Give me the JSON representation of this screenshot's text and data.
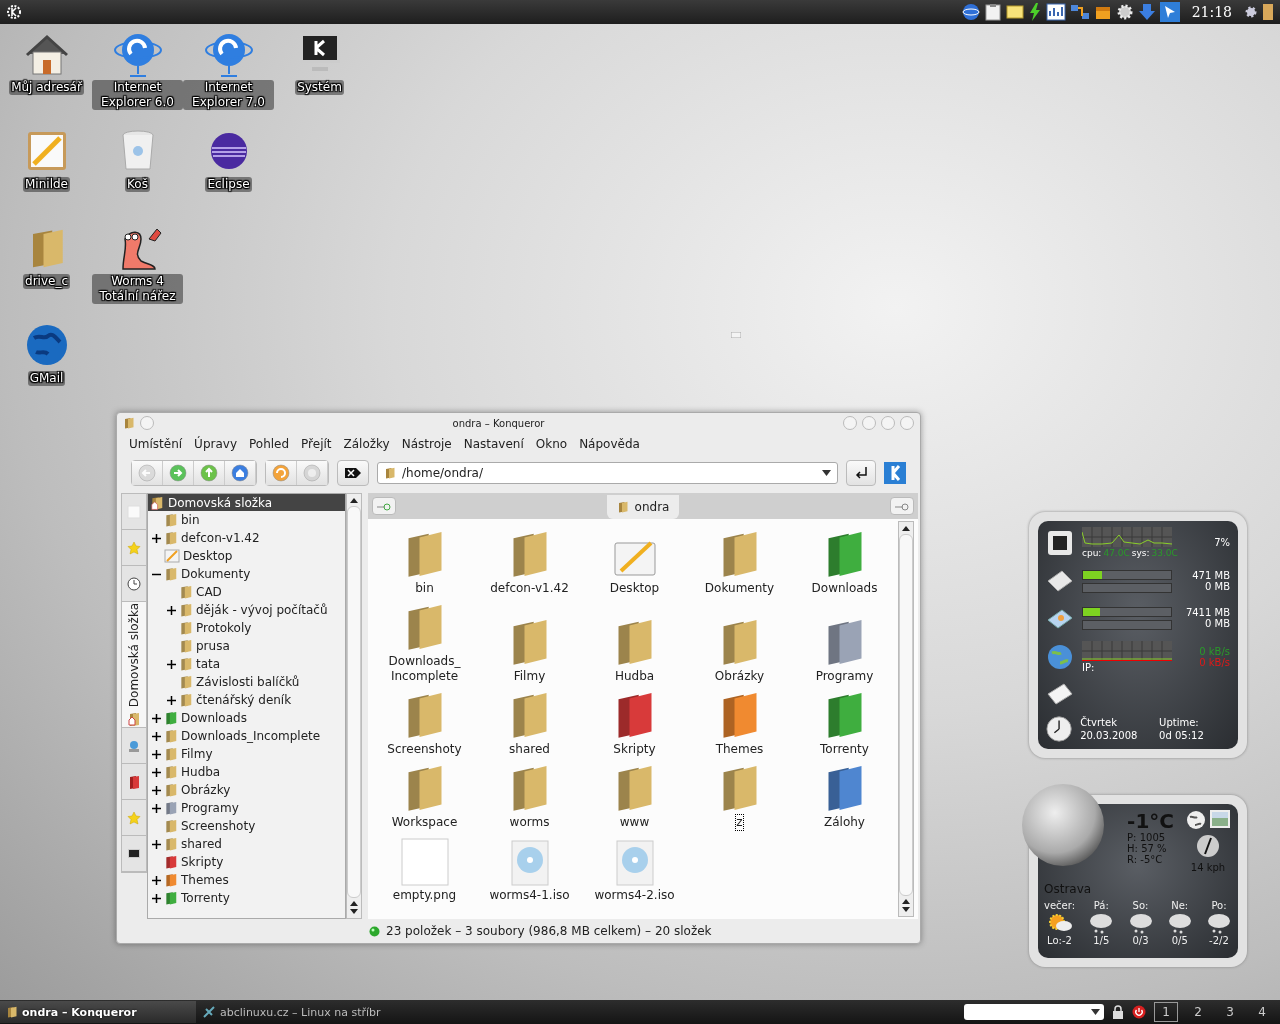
{
  "top_panel": {
    "clock": "21:18"
  },
  "desktop": {
    "rows": [
      {
        "icons": [
          {
            "label": "Můj adresář",
            "kind": "home"
          },
          {
            "label": "Internet Explorer 6.0",
            "kind": "globe-stand"
          },
          {
            "label": "Internet Explorer 7.0",
            "kind": "globe-stand"
          },
          {
            "label": "Systém",
            "kind": "monitor"
          }
        ]
      },
      {
        "icons": [
          {
            "label": "Minilde",
            "kind": "notepad"
          },
          {
            "label": "Koš",
            "kind": "trash"
          },
          {
            "label": "Eclipse",
            "kind": "sphere"
          }
        ]
      },
      {
        "icons": [
          {
            "label": "drive_c",
            "kind": "folder"
          },
          {
            "label": "Worms 4 Totální nářez",
            "kind": "worm"
          }
        ]
      },
      {
        "icons": [
          {
            "label": "GMail",
            "kind": "globe"
          }
        ]
      }
    ]
  },
  "window": {
    "title": "ondra – Konqueror",
    "menu": [
      "Umístění",
      "Úpravy",
      "Pohled",
      "Přejít",
      "Záložky",
      "Nástroje",
      "Nastavení",
      "Okno",
      "Nápověda"
    ],
    "toolbar": [
      {
        "kind": "back",
        "disabled": true
      },
      {
        "kind": "forward",
        "disabled": false
      },
      {
        "kind": "up",
        "disabled": false
      },
      {
        "kind": "home",
        "disabled": false
      },
      {
        "kind": "reload",
        "disabled": false
      },
      {
        "kind": "stop",
        "disabled": true
      }
    ],
    "location": {
      "value": "/home/ondra/"
    },
    "sidebar_tabs": [
      {
        "kind": "blank",
        "selected": false
      },
      {
        "kind": "star",
        "selected": false
      },
      {
        "kind": "clock",
        "selected": false
      },
      {
        "kind": "home",
        "label": "Domovská složka",
        "selected": true
      },
      {
        "kind": "network",
        "selected": false
      },
      {
        "kind": "red-folder",
        "selected": false
      },
      {
        "kind": "star",
        "selected": false
      },
      {
        "kind": "monitor",
        "selected": false
      }
    ],
    "tree": {
      "root": {
        "label": "Domovská složka",
        "selected": true
      },
      "items": [
        {
          "label": "bin",
          "kind": "folder",
          "color": "#d9b86a"
        },
        {
          "label": "defcon-v1.42",
          "kind": "folder",
          "color": "#d9b86a",
          "expanded": false
        },
        {
          "label": "Desktop",
          "kind": "desktop"
        },
        {
          "label": "Dokumenty",
          "kind": "folder",
          "color": "#d9b86a",
          "expanded": true,
          "children": [
            {
              "label": "CAD",
              "kind": "folder",
              "color": "#d9b86a"
            },
            {
              "label": "děják - vývoj počítačů",
              "kind": "folder",
              "color": "#d9b86a",
              "expanded": false
            },
            {
              "label": "Protokoly",
              "kind": "folder",
              "color": "#d9b86a"
            },
            {
              "label": "prusa",
              "kind": "folder",
              "color": "#d9b86a"
            },
            {
              "label": "tata",
              "kind": "folder",
              "color": "#d9b86a",
              "expanded": false
            },
            {
              "label": "Závislosti balíčků",
              "kind": "folder",
              "color": "#d9b86a"
            },
            {
              "label": "čtenářský deník",
              "kind": "folder",
              "color": "#d9b86a",
              "expanded": false
            }
          ]
        },
        {
          "label": "Downloads",
          "kind": "folder",
          "color": "#3fae3f",
          "expanded": false
        },
        {
          "label": "Downloads_Incomplete",
          "kind": "folder",
          "color": "#d9b86a",
          "expanded": false
        },
        {
          "label": "Filmy",
          "kind": "folder",
          "color": "#d9b86a",
          "expanded": false
        },
        {
          "label": "Hudba",
          "kind": "folder",
          "color": "#d9b86a",
          "expanded": false
        },
        {
          "label": "Obrázky",
          "kind": "folder",
          "color": "#d9b86a",
          "expanded": false
        },
        {
          "label": "Programy",
          "kind": "folder",
          "color": "#9aa3b5",
          "expanded": false
        },
        {
          "label": "Screenshoty",
          "kind": "folder",
          "color": "#d9b86a"
        },
        {
          "label": "shared",
          "kind": "folder",
          "color": "#d9b86a",
          "expanded": false
        },
        {
          "label": "Skripty",
          "kind": "folder",
          "color": "#d83a3a"
        },
        {
          "label": "Themes",
          "kind": "folder",
          "color": "#f08a30",
          "expanded": false
        },
        {
          "label": "Torrenty",
          "kind": "folder",
          "color": "#3fae3f",
          "expanded": false
        }
      ]
    },
    "tab": {
      "label": "ondra"
    },
    "files": [
      {
        "label": "bin",
        "kind": "folder",
        "color": "#d9b86a",
        "focused": false
      },
      {
        "label": "defcon-v1.42",
        "kind": "folder",
        "color": "#d9b86a",
        "focused": false
      },
      {
        "label": "Desktop",
        "kind": "desktop",
        "focused": false
      },
      {
        "label": "Dokumenty",
        "kind": "folder",
        "color": "#d9b86a",
        "focused": false
      },
      {
        "label": "Downloads",
        "kind": "folder",
        "color": "#3fae3f",
        "focused": false
      },
      {
        "label": "Downloads_Incomplete",
        "kind": "folder",
        "color": "#d9b86a",
        "focused": false
      },
      {
        "label": "Filmy",
        "kind": "folder",
        "color": "#d9b86a",
        "focused": false
      },
      {
        "label": "Hudba",
        "kind": "folder",
        "color": "#d9b86a",
        "focused": false
      },
      {
        "label": "Obrázky",
        "kind": "folder",
        "color": "#d9b86a",
        "focused": false
      },
      {
        "label": "Programy",
        "kind": "folder",
        "color": "#9aa3b5",
        "focused": false
      },
      {
        "label": "Screenshoty",
        "kind": "folder",
        "color": "#d9b86a",
        "focused": false
      },
      {
        "label": "shared",
        "kind": "folder",
        "color": "#d9b86a",
        "focused": false
      },
      {
        "label": "Skripty",
        "kind": "folder",
        "color": "#d83a3a",
        "focused": false
      },
      {
        "label": "Themes",
        "kind": "folder",
        "color": "#f08a30",
        "focused": false
      },
      {
        "label": "Torrenty",
        "kind": "folder",
        "color": "#3fae3f",
        "focused": false
      },
      {
        "label": "Workspace",
        "kind": "folder",
        "color": "#d9b86a",
        "focused": false
      },
      {
        "label": "worms",
        "kind": "folder",
        "color": "#d9b86a",
        "focused": false
      },
      {
        "label": "www",
        "kind": "folder",
        "color": "#d9b86a",
        "focused": false
      },
      {
        "label": "z",
        "kind": "folder",
        "color": "#d9b86a",
        "focused": true
      },
      {
        "label": "Zálohy",
        "kind": "folder",
        "color": "#4f86d0",
        "focused": false
      },
      {
        "label": "empty.png",
        "kind": "image",
        "focused": false
      },
      {
        "label": "worms4-1.iso",
        "kind": "disc",
        "focused": false
      },
      {
        "label": "worms4-2.iso",
        "kind": "disc",
        "focused": false
      }
    ],
    "status": "23 položek – 3 soubory (986,8 MB celkem) – 20 složek"
  },
  "sysmon": {
    "cpu_percent": "7%",
    "cpu_label": "cpu:",
    "cpu_temp": "47.0C",
    "sys_label": "sys:",
    "sys_temp": "33.0C",
    "memory": [
      {
        "reading": "471 MB",
        "level": 0.22
      },
      {
        "reading": "0 MB",
        "level": 0
      }
    ],
    "disk": [
      {
        "reading": "7411 MB",
        "level": 0.19
      },
      {
        "reading": "0 MB",
        "level": 0
      }
    ],
    "net_in": "0 kB/s",
    "net_out": "0 kB/s",
    "ip_label": "IP:",
    "day": "Čtvrtek",
    "date": "20.03.2008",
    "uptime_label": "Uptime:",
    "uptime": "0d 05:12"
  },
  "weather": {
    "temperature": "-1°C",
    "pressure": "P: 1005",
    "humidity": "H: 57 %",
    "realfeel": "R: -5°C",
    "wind": "14 kph",
    "city": "Ostrava",
    "forecast": [
      {
        "day": "večer:",
        "kind": "sun-cloud",
        "temps": "Lo:-2"
      },
      {
        "day": "Pá:",
        "kind": "snow",
        "temps": "1/5"
      },
      {
        "day": "So:",
        "kind": "snow",
        "temps": "0/3"
      },
      {
        "day": "Ne:",
        "kind": "snow",
        "temps": "0/5"
      },
      {
        "day": "Po:",
        "kind": "snow",
        "temps": "-2/2"
      }
    ]
  },
  "taskbar": {
    "tasks": [
      {
        "label": "ondra – Konqueror",
        "selected": true
      },
      {
        "label": "abclinuxu.cz – Linux na stříbr",
        "selected": false
      }
    ],
    "desktops": [
      {
        "label": "1",
        "selected": true
      },
      {
        "label": "2",
        "selected": false
      },
      {
        "label": "3",
        "selected": false
      },
      {
        "label": "4",
        "selected": false
      }
    ]
  }
}
